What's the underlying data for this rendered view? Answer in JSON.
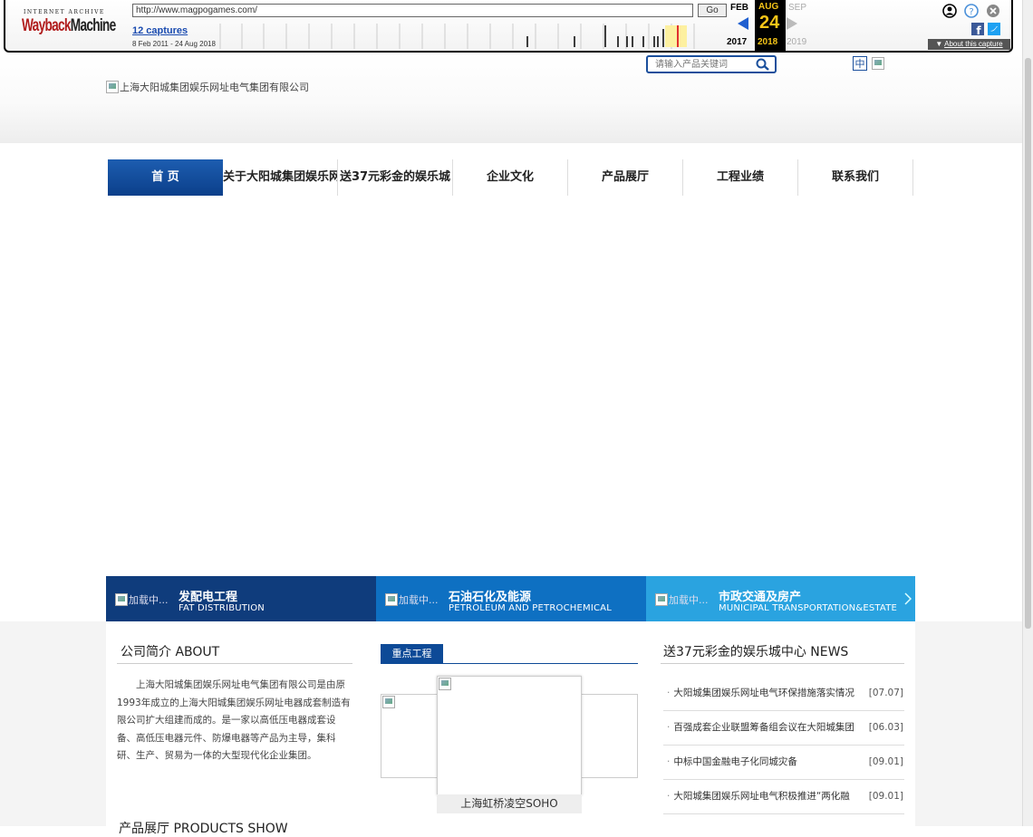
{
  "wayback": {
    "logo_top": "INTERNET ARCHIVE",
    "logo_main_a": "Wayback",
    "logo_main_b": "Machine",
    "url": "http://www.magpogames.com/",
    "go_label": "Go",
    "captures": "12 captures",
    "range": "8 Feb 2011 - 24 Aug 2018",
    "months": {
      "prev": "FEB",
      "cur": "AUG",
      "next": "SEP"
    },
    "day": "24",
    "years": {
      "prev": "2017",
      "cur": "2018",
      "next": "2019"
    },
    "about": "About this capture",
    "colors": {
      "accent": "#f5c518",
      "blue": "#1f5fd0"
    }
  },
  "header": {
    "logo_alt": "上海大阳城集团娱乐网址电气集团有限公司",
    "search_placeholder": "请输入产品关键词",
    "lang_cn": "中"
  },
  "nav": {
    "items": [
      "首 页",
      "关于大阳城集团娱乐网",
      "送37元彩金的娱乐城",
      "企业文化",
      "产品展厅",
      "工程业绩",
      "联系我们"
    ]
  },
  "tiles": [
    {
      "img_alt": "加载中...",
      "title": "发配电工程",
      "subtitle": "FAT DISTRIBUTION",
      "color": "#0f3c7c"
    },
    {
      "img_alt": "加载中...",
      "title": "石油石化及能源",
      "subtitle": "PETROLEUM AND PETROCHEMICAL",
      "color": "#0e70c2"
    },
    {
      "img_alt": "加载中...",
      "title": "市政交通及房产",
      "subtitle": "MUNICIPAL TRANSPORTATION&ESTATE",
      "color": "#2aa3e0"
    }
  ],
  "about": {
    "title": "公司简介 ABOUT",
    "text": "上海大阳城集团娱乐网址电气集团有限公司是由原1993年成立的上海大阳城集团娱乐网址电器成套制造有限公司扩大组建而成的。是一家以高低压电器成套设备、高低压电器元件、防爆电器等产品为主导，集科研、生产、贸易为一体的大型现代化企业集团。"
  },
  "projects": {
    "tab": "重点工程",
    "caption": "上海虹桥凌空SOHO"
  },
  "news": {
    "title": "送37元彩金的娱乐城中心 NEWS",
    "items": [
      {
        "text": "大阳城集团娱乐网址电气环保措施落实情况",
        "date": "[07.07]"
      },
      {
        "text": "百强成套企业联盟筹备组会议在大阳城集团",
        "date": "[06.03]"
      },
      {
        "text": "中标中国金融电子化同城灾备",
        "date": "[09.01]"
      },
      {
        "text": "大阳城集团娱乐网址电气积极推进“两化融",
        "date": "[09.01]"
      }
    ]
  },
  "products": {
    "title": "产品展厅 PRODUCTS SHOW"
  }
}
